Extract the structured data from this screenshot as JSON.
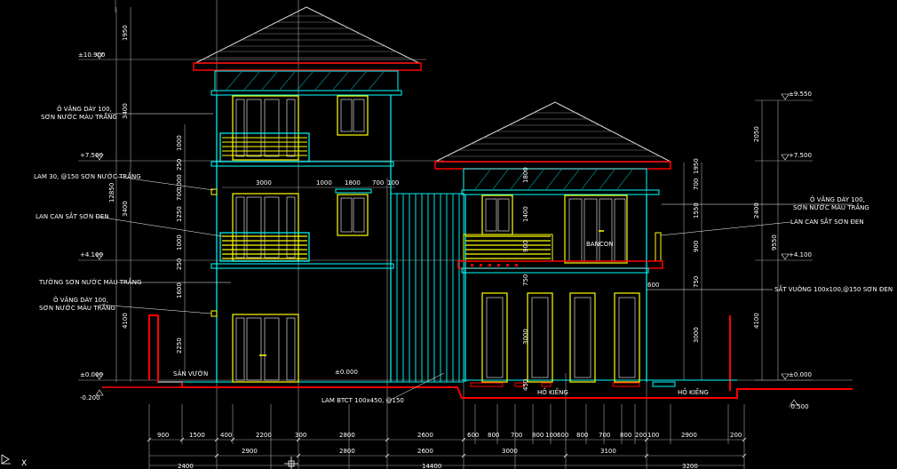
{
  "colors": {
    "background": "#000000",
    "wall": "#00ffff",
    "window": "#ffff00",
    "roof": "#c8c8c8",
    "ground": "#ff0000",
    "dimension": "#ffffff",
    "grid": "#b0b0b0",
    "accent": "#ff00ff"
  },
  "levels_left": [
    {
      "label": "±10.900"
    },
    {
      "label": "+7.500"
    },
    {
      "label": "+4.100"
    },
    {
      "label": "±0.000"
    },
    {
      "label": "-0.200"
    }
  ],
  "levels_right": [
    {
      "label": "±9.550"
    },
    {
      "label": "+7.500"
    },
    {
      "label": "+4.100"
    },
    {
      "label": "±0.000"
    },
    {
      "label": "-0.500"
    }
  ],
  "notes_left": [
    "Ô VĂNG DÀY 100,",
    "SƠN NƯỚC MÀU TRẮNG",
    "LAM 30, @150 SƠN NƯỚC TRẮNG",
    "LAN CAN SẮT SƠN ĐEN",
    "TƯỜNG SƠN NƯỚC MÀU TRẮNG",
    "Ô VĂNG DÀY 100,",
    "SƠN NƯỚC MÀU TRẮNG"
  ],
  "notes_right": [
    "Ô VĂNG DÀY 100,",
    "SƠN NƯỚC MÀU TRẮNG",
    "LAN CAN SẮT SƠN ĐEN",
    "SẮT VUÔNG 100x100,@150 SƠN ĐEN"
  ],
  "labels": {
    "garden": "SÂN VƯỜN",
    "balcony": "BANCON",
    "pond1": "HỒ KIẾNG",
    "pond2": "HỒ KIẾNG",
    "lam": "LAM BTCT 100x450, @150",
    "level_mid": "±0.000"
  },
  "vdims_left": [
    "1950",
    "3400",
    "12850",
    "3400",
    "1000",
    "250",
    "1000",
    "700",
    "1250",
    "1000",
    "250",
    "1600",
    "2250",
    "4100"
  ],
  "vdims_right": [
    "2050",
    "2400",
    "9550",
    "4100",
    "1950",
    "700",
    "1550",
    "900",
    "750",
    "1400",
    "900",
    "750",
    "3000",
    "3000",
    "450",
    "1800"
  ],
  "hdims_top": [
    "3000",
    "1000",
    "1800",
    "700",
    "100"
  ],
  "hdims_row1": [
    "900",
    "1500",
    "400",
    "2200",
    "300",
    "2800",
    "2600",
    "600",
    "800",
    "700",
    "800",
    "100",
    "600",
    "800",
    "700",
    "800",
    "200",
    "100",
    "2900",
    "200"
  ],
  "hdims_row2": [
    "2900",
    "2800",
    "2600",
    "3000",
    "3100"
  ],
  "hdims_row3": [
    "2400",
    "14400",
    "3200"
  ],
  "misc_dims": [
    "600"
  ]
}
